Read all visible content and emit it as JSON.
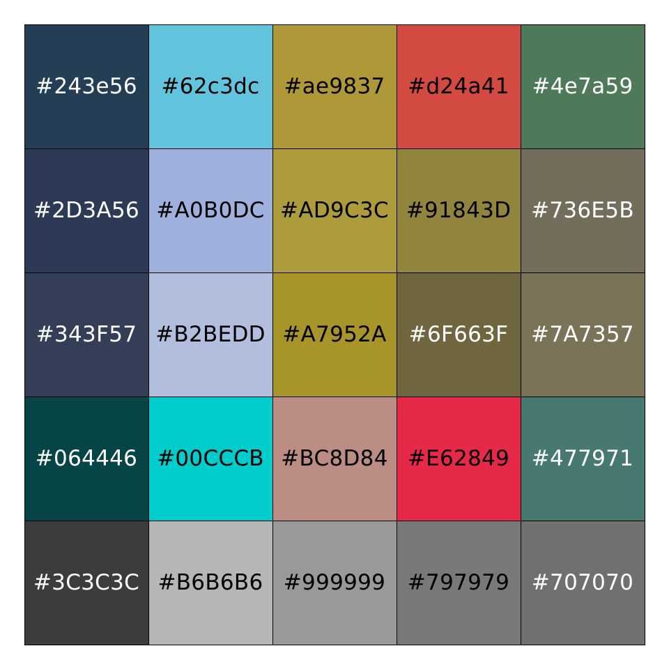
{
  "chart_data": {
    "type": "heatmap",
    "title": "",
    "rows": [
      [
        {
          "label": "#243e56",
          "color": "#243e56",
          "text_color": "#ffffff"
        },
        {
          "label": "#62c3dc",
          "color": "#62c3dc",
          "text_color": "#000000"
        },
        {
          "label": "#ae9837",
          "color": "#ae9837",
          "text_color": "#000000"
        },
        {
          "label": "#d24a41",
          "color": "#d24a41",
          "text_color": "#000000"
        },
        {
          "label": "#4e7a59",
          "color": "#4e7a59",
          "text_color": "#ffffff"
        }
      ],
      [
        {
          "label": "#2D3A56",
          "color": "#2D3A56",
          "text_color": "#ffffff"
        },
        {
          "label": "#A0B0DC",
          "color": "#A0B0DC",
          "text_color": "#000000"
        },
        {
          "label": "#AD9C3C",
          "color": "#AD9C3C",
          "text_color": "#000000"
        },
        {
          "label": "#91843D",
          "color": "#91843D",
          "text_color": "#000000"
        },
        {
          "label": "#736E5B",
          "color": "#736E5B",
          "text_color": "#ffffff"
        }
      ],
      [
        {
          "label": "#343F57",
          "color": "#343F57",
          "text_color": "#ffffff"
        },
        {
          "label": "#B2BEDD",
          "color": "#B2BEDD",
          "text_color": "#000000"
        },
        {
          "label": "#A7952A",
          "color": "#A7952A",
          "text_color": "#000000"
        },
        {
          "label": "#6F663F",
          "color": "#6F663F",
          "text_color": "#ffffff"
        },
        {
          "label": "#7A7357",
          "color": "#7A7357",
          "text_color": "#ffffff"
        }
      ],
      [
        {
          "label": "#064446",
          "color": "#064446",
          "text_color": "#ffffff"
        },
        {
          "label": "#00CCCB",
          "color": "#00CCCB",
          "text_color": "#000000"
        },
        {
          "label": "#BC8D84",
          "color": "#BC8D84",
          "text_color": "#000000"
        },
        {
          "label": "#E62849",
          "color": "#E62849",
          "text_color": "#000000"
        },
        {
          "label": "#477971",
          "color": "#477971",
          "text_color": "#ffffff"
        }
      ],
      [
        {
          "label": "#3C3C3C",
          "color": "#3C3C3C",
          "text_color": "#ffffff"
        },
        {
          "label": "#B6B6B6",
          "color": "#B6B6B6",
          "text_color": "#000000"
        },
        {
          "label": "#999999",
          "color": "#999999",
          "text_color": "#000000"
        },
        {
          "label": "#797979",
          "color": "#797979",
          "text_color": "#000000"
        },
        {
          "label": "#707070",
          "color": "#707070",
          "text_color": "#ffffff"
        }
      ]
    ],
    "grid": true,
    "legend": "none"
  }
}
